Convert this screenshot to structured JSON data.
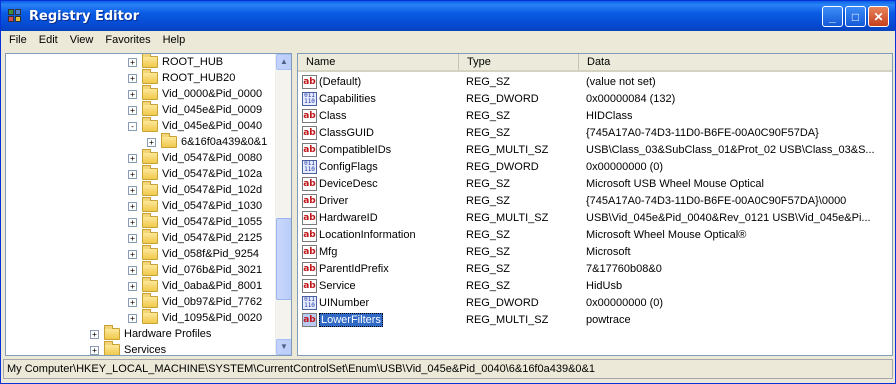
{
  "window": {
    "title": "Registry Editor",
    "minimize": "_",
    "maximize": "□",
    "close": "✕"
  },
  "menu": [
    "File",
    "Edit",
    "View",
    "Favorites",
    "Help"
  ],
  "tree": [
    {
      "label": "ROOT_HUB",
      "pm": "+"
    },
    {
      "label": "ROOT_HUB20",
      "pm": "+"
    },
    {
      "label": "Vid_0000&Pid_0000",
      "pm": "+"
    },
    {
      "label": "Vid_045e&Pid_0009",
      "pm": "+"
    },
    {
      "label": "Vid_045e&Pid_0040",
      "pm": "-"
    },
    {
      "label": "6&16f0a439&0&1",
      "pm": "+"
    },
    {
      "label": "Vid_0547&Pid_0080",
      "pm": "+"
    },
    {
      "label": "Vid_0547&Pid_102a",
      "pm": "+"
    },
    {
      "label": "Vid_0547&Pid_102d",
      "pm": "+"
    },
    {
      "label": "Vid_0547&Pid_1030",
      "pm": "+"
    },
    {
      "label": "Vid_0547&Pid_1055",
      "pm": "+"
    },
    {
      "label": "Vid_0547&Pid_2125",
      "pm": "+"
    },
    {
      "label": "Vid_058f&Pid_9254",
      "pm": "+"
    },
    {
      "label": "Vid_076b&Pid_3021",
      "pm": "+"
    },
    {
      "label": "Vid_0aba&Pid_8001",
      "pm": "+"
    },
    {
      "label": "Vid_0b97&Pid_7762",
      "pm": "+"
    },
    {
      "label": "Vid_1095&Pid_0020",
      "pm": "+"
    },
    {
      "label": "Hardware Profiles",
      "pm": "+"
    },
    {
      "label": "Services",
      "pm": "+"
    }
  ],
  "columns": {
    "name": "Name",
    "type": "Type",
    "data": "Data"
  },
  "values": [
    {
      "name": "(Default)",
      "type": "REG_SZ",
      "data": "(value not set)",
      "icon": "ab"
    },
    {
      "name": "Capabilities",
      "type": "REG_DWORD",
      "data": "0x00000084 (132)",
      "icon": "bin"
    },
    {
      "name": "Class",
      "type": "REG_SZ",
      "data": "HIDClass",
      "icon": "ab"
    },
    {
      "name": "ClassGUID",
      "type": "REG_SZ",
      "data": "{745A17A0-74D3-11D0-B6FE-00A0C90F57DA}",
      "icon": "ab"
    },
    {
      "name": "CompatibleIDs",
      "type": "REG_MULTI_SZ",
      "data": "USB\\Class_03&SubClass_01&Prot_02 USB\\Class_03&S...",
      "icon": "ab"
    },
    {
      "name": "ConfigFlags",
      "type": "REG_DWORD",
      "data": "0x00000000 (0)",
      "icon": "bin"
    },
    {
      "name": "DeviceDesc",
      "type": "REG_SZ",
      "data": "Microsoft USB Wheel Mouse Optical",
      "icon": "ab"
    },
    {
      "name": "Driver",
      "type": "REG_SZ",
      "data": "{745A17A0-74D3-11D0-B6FE-00A0C90F57DA}\\0000",
      "icon": "ab"
    },
    {
      "name": "HardwareID",
      "type": "REG_MULTI_SZ",
      "data": "USB\\Vid_045e&Pid_0040&Rev_0121 USB\\Vid_045e&Pi...",
      "icon": "ab"
    },
    {
      "name": "LocationInformation",
      "type": "REG_SZ",
      "data": "Microsoft Wheel Mouse Optical®",
      "icon": "ab"
    },
    {
      "name": "Mfg",
      "type": "REG_SZ",
      "data": "Microsoft",
      "icon": "ab"
    },
    {
      "name": "ParentIdPrefix",
      "type": "REG_SZ",
      "data": "7&17760b08&0",
      "icon": "ab"
    },
    {
      "name": "Service",
      "type": "REG_SZ",
      "data": "HidUsb",
      "icon": "ab"
    },
    {
      "name": "UINumber",
      "type": "REG_DWORD",
      "data": "0x00000000 (0)",
      "icon": "bin"
    },
    {
      "name": "LowerFilters",
      "type": "REG_MULTI_SZ",
      "data": "powtrace",
      "icon": "ab",
      "selected": true
    }
  ],
  "status": "My Computer\\HKEY_LOCAL_MACHINE\\SYSTEM\\CurrentControlSet\\Enum\\USB\\Vid_045e&Pid_0040\\6&16f0a439&0&1"
}
